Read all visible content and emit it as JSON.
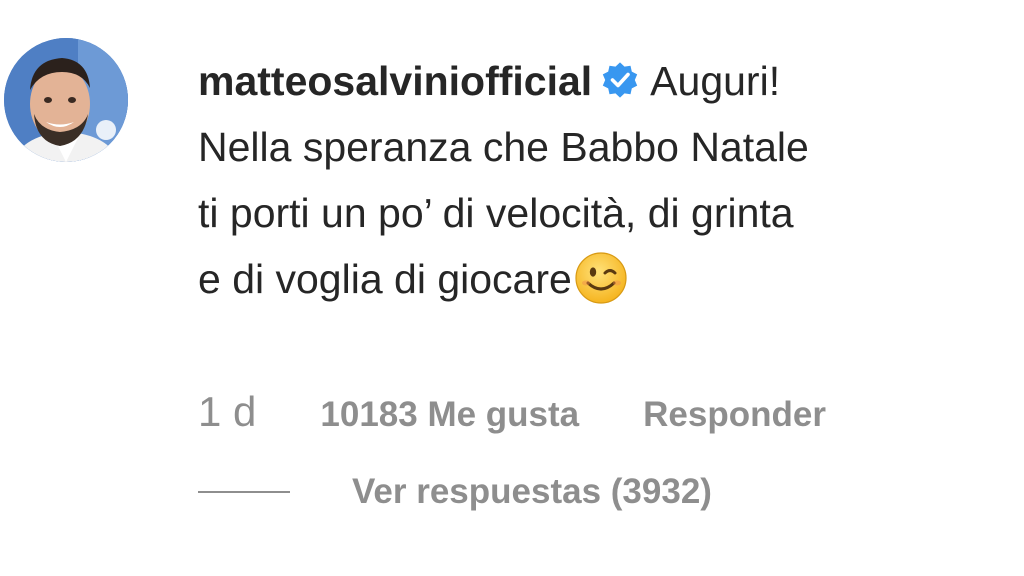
{
  "comment": {
    "author": {
      "username": "matteosalviniofficial",
      "verified": true,
      "verified_icon": "verified-badge-icon",
      "verified_color": "#3897f0",
      "avatar_background": "#4f7fc4"
    },
    "text_first": "Auguri!",
    "text_lines": [
      "Nella speranza che Babbo Natale",
      "ti porti un po’ di velocità, di grinta",
      "e di voglia di giocare"
    ],
    "emoji": "winking-face-icon",
    "timestamp": "1 d",
    "likes_label": "10183 Me gusta",
    "reply_label": "Responder",
    "view_replies_label": "Ver respuestas (3932)"
  }
}
